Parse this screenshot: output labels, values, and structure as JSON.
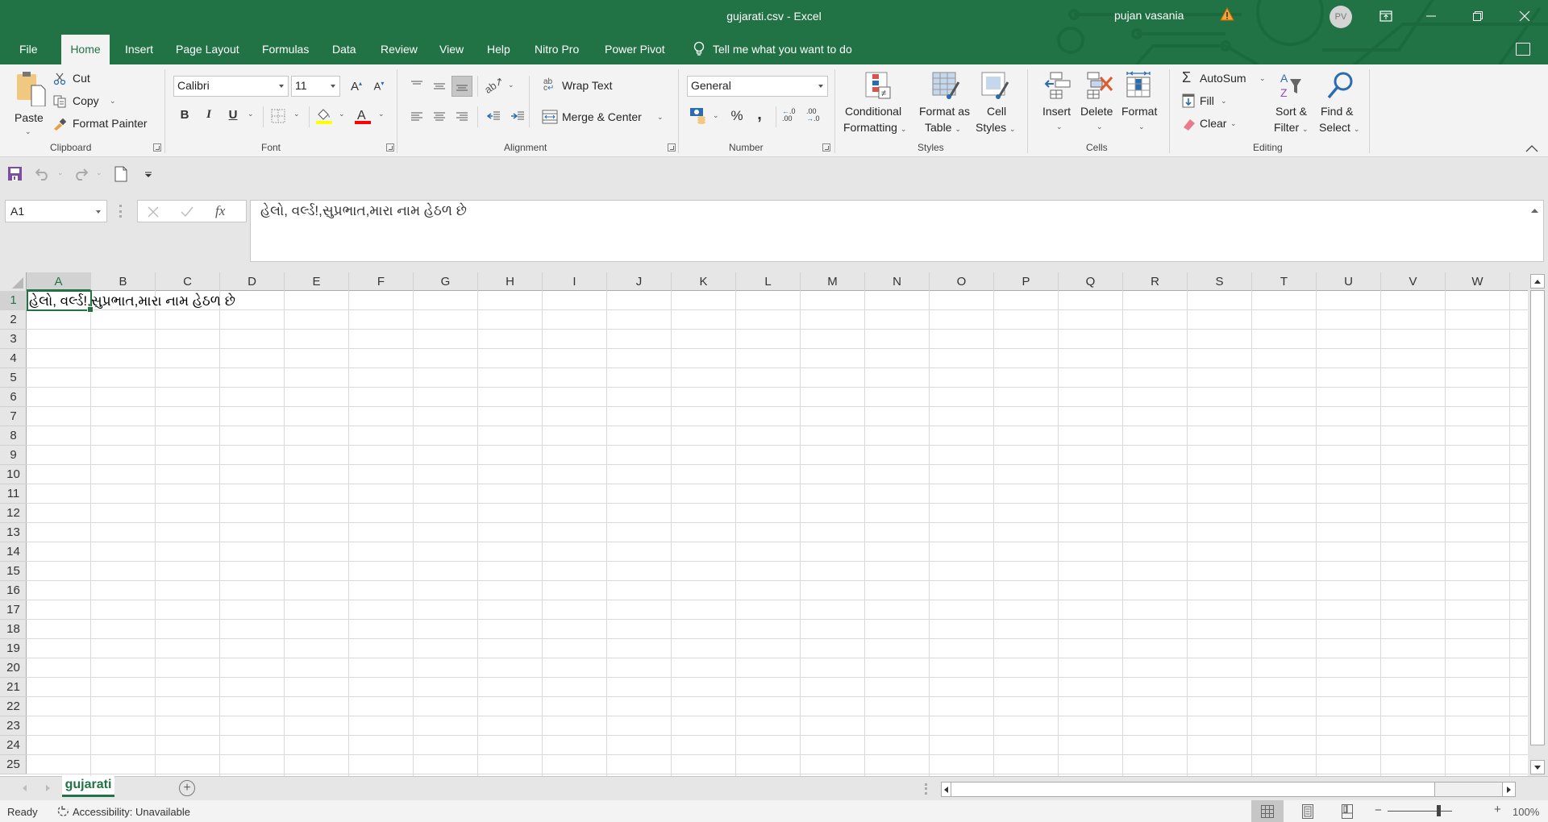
{
  "app": {
    "window_title": "gujarati.csv  -  Excel",
    "user_name": "pujan vasania",
    "user_initials": "PV",
    "accent_color": "#217346"
  },
  "tabs": [
    {
      "label": "File",
      "active": false
    },
    {
      "label": "Home",
      "active": true
    },
    {
      "label": "Insert",
      "active": false
    },
    {
      "label": "Page Layout",
      "active": false
    },
    {
      "label": "Formulas",
      "active": false
    },
    {
      "label": "Data",
      "active": false
    },
    {
      "label": "Review",
      "active": false
    },
    {
      "label": "View",
      "active": false
    },
    {
      "label": "Help",
      "active": false
    },
    {
      "label": "Nitro Pro",
      "active": false
    },
    {
      "label": "Power Pivot",
      "active": false
    }
  ],
  "tell_me": "Tell me what you want to do",
  "ribbon": {
    "clipboard": {
      "label": "Clipboard",
      "paste": "Paste",
      "cut": "Cut",
      "copy": "Copy",
      "format_painter": "Format Painter"
    },
    "font": {
      "label": "Font",
      "font_name": "Calibri",
      "font_size": "11",
      "bold": "B",
      "italic": "I",
      "underline": "U",
      "fill_color": "#ffff00",
      "font_color": "#ff0000"
    },
    "alignment": {
      "label": "Alignment",
      "wrap_text": "Wrap Text",
      "merge_center": "Merge & Center"
    },
    "number": {
      "label": "Number",
      "format": "General",
      "percent": "%",
      "comma": ","
    },
    "styles": {
      "label": "Styles",
      "conditional_formatting": [
        "Conditional",
        "Formatting"
      ],
      "format_as_table": [
        "Format as",
        "Table"
      ],
      "cell_styles": [
        "Cell",
        "Styles"
      ]
    },
    "cells": {
      "label": "Cells",
      "insert": "Insert",
      "delete": "Delete",
      "format": "Format"
    },
    "editing": {
      "label": "Editing",
      "autosum": "AutoSum",
      "fill": "Fill",
      "clear": "Clear",
      "sort_filter": [
        "Sort &",
        "Filter"
      ],
      "find_select": [
        "Find &",
        "Select"
      ]
    }
  },
  "formula_bar": {
    "name_box": "A1",
    "fx": "fx",
    "formula": "હેલો, વર્લ્ડ!,સુપ્રભાત,મારા નામ હેઠળ છે"
  },
  "grid": {
    "columns": [
      "A",
      "B",
      "C",
      "D",
      "E",
      "F",
      "G",
      "H",
      "I",
      "J",
      "K",
      "L",
      "M",
      "N",
      "O",
      "P",
      "Q",
      "R",
      "S",
      "T",
      "U",
      "V",
      "W"
    ],
    "rows": [
      "1",
      "2",
      "3",
      "4",
      "5",
      "6",
      "7",
      "8",
      "9",
      "10",
      "11",
      "12",
      "13",
      "14",
      "15",
      "16",
      "17",
      "18",
      "19",
      "20",
      "21",
      "22",
      "23",
      "24",
      "25"
    ],
    "selected_cell": "A1",
    "cells": {
      "A1": "હેલો, વર્લ્ડ!,સુપ્રભાત,મારા નામ હેઠળ છે"
    }
  },
  "sheets": [
    {
      "name": "gujarati",
      "active": true
    }
  ],
  "status": {
    "ready": "Ready",
    "accessibility": "Accessibility: Unavailable",
    "zoom": "100%",
    "zoom_minus": "−",
    "zoom_plus": "+"
  }
}
